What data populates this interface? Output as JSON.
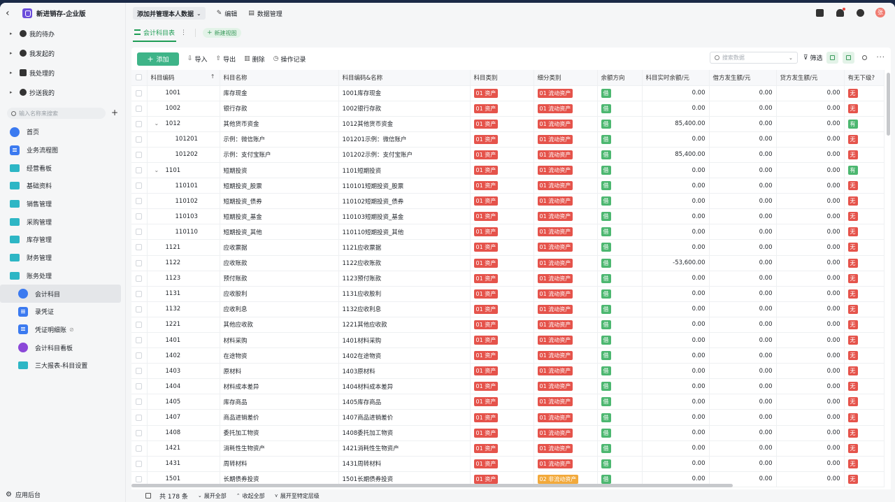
{
  "app": {
    "name": "新进销存-企业版"
  },
  "todos": [
    {
      "label": "我的待办"
    },
    {
      "label": "我发起的"
    },
    {
      "label": "我处理的"
    },
    {
      "label": "抄送我的"
    }
  ],
  "sidebar_search": {
    "placeholder": "输入名称来搜索"
  },
  "nav": [
    {
      "label": "首页",
      "icon": "home-icon"
    },
    {
      "label": "业务流程图",
      "icon": "document-icon"
    },
    {
      "label": "经营看板",
      "icon": "folder-icon"
    },
    {
      "label": "基础资料",
      "icon": "folder-icon"
    },
    {
      "label": "销售管理",
      "icon": "folder-icon"
    },
    {
      "label": "采购管理",
      "icon": "folder-icon"
    },
    {
      "label": "库存管理",
      "icon": "folder-icon"
    },
    {
      "label": "财务管理",
      "icon": "folder-icon"
    },
    {
      "label": "账务处理",
      "icon": "folder-icon"
    }
  ],
  "subnav": [
    {
      "label": "会计科目",
      "icon": "house-icon",
      "active": true
    },
    {
      "label": "录凭证",
      "icon": "document-icon"
    },
    {
      "label": "凭证明细账",
      "icon": "document-icon",
      "hidden_badge": true
    },
    {
      "label": "会计科目看板",
      "icon": "chart-icon"
    },
    {
      "label": "三大报表-科目设置",
      "icon": "folder-icon"
    }
  ],
  "footer_sidebar": {
    "label": "应用后台"
  },
  "topbar": {
    "view_select": "添加并管理本人数据",
    "edit": "编辑",
    "data_manage": "数据管理",
    "avatar_text": "张"
  },
  "tabs": {
    "active": "会计科目表",
    "new_view": "新建视图"
  },
  "toolbar": {
    "add": "添加",
    "import": "导入",
    "export": "导出",
    "delete": "删除",
    "log": "操作记录",
    "search_placeholder": "搜索数据",
    "filter": "筛选"
  },
  "table": {
    "columns": [
      "科目编码",
      "科目名称",
      "科目编码&名称",
      "科目类别",
      "细分类别",
      "余额方向",
      "科目实时余额/元",
      "借方发生额/元",
      "贷方发生额/元",
      "有无下级?"
    ],
    "rows": [
      {
        "code": "1001",
        "name": "库存现金",
        "codename": "1001库存现金",
        "cat": "01 资产",
        "sub": "01 流动资产",
        "dir": "借",
        "bal": "0.00",
        "debit": "0.00",
        "credit": "0.00",
        "has": "无",
        "level": 0
      },
      {
        "code": "1002",
        "name": "银行存款",
        "codename": "1002银行存款",
        "cat": "01 资产",
        "sub": "01 流动资产",
        "dir": "借",
        "bal": "0.00",
        "debit": "0.00",
        "credit": "0.00",
        "has": "无",
        "level": 0
      },
      {
        "code": "1012",
        "name": "其他货币资金",
        "codename": "1012其他货币资金",
        "cat": "01 资产",
        "sub": "01 流动资产",
        "dir": "借",
        "bal": "85,400.00",
        "debit": "0.00",
        "credit": "0.00",
        "has": "有",
        "level": 1
      },
      {
        "code": "101201",
        "name": "示例：微信账户",
        "codename": "101201示例：微信账户",
        "cat": "01 资产",
        "sub": "01 流动资产",
        "dir": "借",
        "bal": "0.00",
        "debit": "0.00",
        "credit": "0.00",
        "has": "无",
        "level": 2
      },
      {
        "code": "101202",
        "name": "示例：支付宝账户",
        "codename": "101202示例：支付宝账户",
        "cat": "01 资产",
        "sub": "01 流动资产",
        "dir": "借",
        "bal": "85,400.00",
        "debit": "0.00",
        "credit": "0.00",
        "has": "无",
        "level": 2
      },
      {
        "code": "1101",
        "name": "短期投资",
        "codename": "1101短期投资",
        "cat": "01 资产",
        "sub": "01 流动资产",
        "dir": "借",
        "bal": "0.00",
        "debit": "0.00",
        "credit": "0.00",
        "has": "有",
        "level": 1
      },
      {
        "code": "110101",
        "name": "短期投资_股票",
        "codename": "110101短期投资_股票",
        "cat": "01 资产",
        "sub": "01 流动资产",
        "dir": "借",
        "bal": "0.00",
        "debit": "0.00",
        "credit": "0.00",
        "has": "无",
        "level": 2
      },
      {
        "code": "110102",
        "name": "短期投资_债券",
        "codename": "110102短期投资_债券",
        "cat": "01 资产",
        "sub": "01 流动资产",
        "dir": "借",
        "bal": "0.00",
        "debit": "0.00",
        "credit": "0.00",
        "has": "无",
        "level": 2
      },
      {
        "code": "110103",
        "name": "短期投资_基金",
        "codename": "110103短期投资_基金",
        "cat": "01 资产",
        "sub": "01 流动资产",
        "dir": "借",
        "bal": "0.00",
        "debit": "0.00",
        "credit": "0.00",
        "has": "无",
        "level": 2
      },
      {
        "code": "110110",
        "name": "短期投资_其他",
        "codename": "110110短期投资_其他",
        "cat": "01 资产",
        "sub": "01 流动资产",
        "dir": "借",
        "bal": "0.00",
        "debit": "0.00",
        "credit": "0.00",
        "has": "无",
        "level": 2
      },
      {
        "code": "1121",
        "name": "应收票据",
        "codename": "1121应收票据",
        "cat": "01 资产",
        "sub": "01 流动资产",
        "dir": "借",
        "bal": "0.00",
        "debit": "0.00",
        "credit": "0.00",
        "has": "无",
        "level": 0
      },
      {
        "code": "1122",
        "name": "应收账款",
        "codename": "1122应收账款",
        "cat": "01 资产",
        "sub": "01 流动资产",
        "dir": "借",
        "bal": "-53,600.00",
        "debit": "0.00",
        "credit": "0.00",
        "has": "无",
        "level": 0
      },
      {
        "code": "1123",
        "name": "预付账款",
        "codename": "1123预付账款",
        "cat": "01 资产",
        "sub": "01 流动资产",
        "dir": "借",
        "bal": "0.00",
        "debit": "0.00",
        "credit": "0.00",
        "has": "无",
        "level": 0
      },
      {
        "code": "1131",
        "name": "应收股利",
        "codename": "1131应收股利",
        "cat": "01 资产",
        "sub": "01 流动资产",
        "dir": "借",
        "bal": "0.00",
        "debit": "0.00",
        "credit": "0.00",
        "has": "无",
        "level": 0
      },
      {
        "code": "1132",
        "name": "应收利息",
        "codename": "1132应收利息",
        "cat": "01 资产",
        "sub": "01 流动资产",
        "dir": "借",
        "bal": "0.00",
        "debit": "0.00",
        "credit": "0.00",
        "has": "无",
        "level": 0
      },
      {
        "code": "1221",
        "name": "其他应收款",
        "codename": "1221其他应收款",
        "cat": "01 资产",
        "sub": "01 流动资产",
        "dir": "借",
        "bal": "0.00",
        "debit": "0.00",
        "credit": "0.00",
        "has": "无",
        "level": 0
      },
      {
        "code": "1401",
        "name": "材料采购",
        "codename": "1401材料采购",
        "cat": "01 资产",
        "sub": "01 流动资产",
        "dir": "借",
        "bal": "0.00",
        "debit": "0.00",
        "credit": "0.00",
        "has": "无",
        "level": 0
      },
      {
        "code": "1402",
        "name": "在途物资",
        "codename": "1402在途物资",
        "cat": "01 资产",
        "sub": "01 流动资产",
        "dir": "借",
        "bal": "0.00",
        "debit": "0.00",
        "credit": "0.00",
        "has": "无",
        "level": 0
      },
      {
        "code": "1403",
        "name": "原材料",
        "codename": "1403原材料",
        "cat": "01 资产",
        "sub": "01 流动资产",
        "dir": "借",
        "bal": "0.00",
        "debit": "0.00",
        "credit": "0.00",
        "has": "无",
        "level": 0
      },
      {
        "code": "1404",
        "name": "材料成本差异",
        "codename": "1404材料成本差异",
        "cat": "01 资产",
        "sub": "01 流动资产",
        "dir": "借",
        "bal": "0.00",
        "debit": "0.00",
        "credit": "0.00",
        "has": "无",
        "level": 0
      },
      {
        "code": "1405",
        "name": "库存商品",
        "codename": "1405库存商品",
        "cat": "01 资产",
        "sub": "01 流动资产",
        "dir": "借",
        "bal": "0.00",
        "debit": "0.00",
        "credit": "0.00",
        "has": "无",
        "level": 0
      },
      {
        "code": "1407",
        "name": "商品进销差价",
        "codename": "1407商品进销差价",
        "cat": "01 资产",
        "sub": "01 流动资产",
        "dir": "借",
        "bal": "0.00",
        "debit": "0.00",
        "credit": "0.00",
        "has": "无",
        "level": 0
      },
      {
        "code": "1408",
        "name": "委托加工物资",
        "codename": "1408委托加工物资",
        "cat": "01 资产",
        "sub": "01 流动资产",
        "dir": "借",
        "bal": "0.00",
        "debit": "0.00",
        "credit": "0.00",
        "has": "无",
        "level": 0
      },
      {
        "code": "1421",
        "name": "消耗性生物资产",
        "codename": "1421消耗性生物资产",
        "cat": "01 资产",
        "sub": "01 流动资产",
        "dir": "借",
        "bal": "0.00",
        "debit": "0.00",
        "credit": "0.00",
        "has": "无",
        "level": 0
      },
      {
        "code": "1431",
        "name": "周转材料",
        "codename": "1431周转材料",
        "cat": "01 资产",
        "sub": "01 流动资产",
        "dir": "借",
        "bal": "0.00",
        "debit": "0.00",
        "credit": "0.00",
        "has": "无",
        "level": 0
      },
      {
        "code": "1501",
        "name": "长期债券投资",
        "codename": "1501长期债券投资",
        "cat": "01 资产",
        "sub": "02 非流动资产",
        "dir": "借",
        "bal": "0.00",
        "debit": "0.00",
        "credit": "0.00",
        "has": "无",
        "level": 0
      }
    ]
  },
  "footer": {
    "count": "共 178 条",
    "expand_all": "展开全部",
    "collapse_all": "收起全部",
    "expand_level": "展开至特定层级"
  }
}
